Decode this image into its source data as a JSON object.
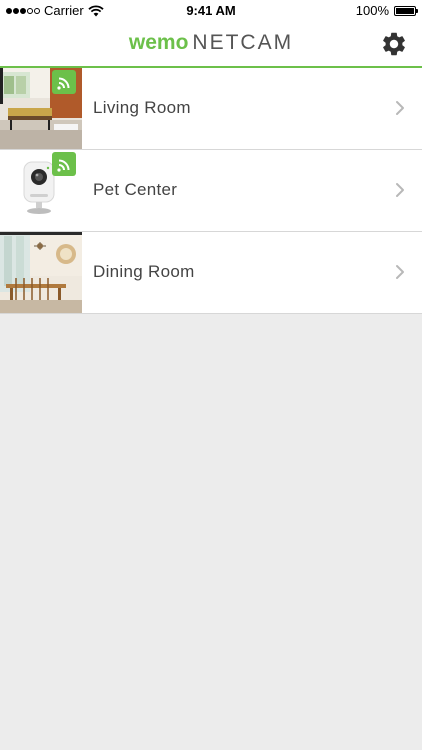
{
  "status_bar": {
    "carrier": "Carrier",
    "time": "9:41 AM",
    "battery": "100%",
    "signal_bars_filled": 3,
    "signal_bars_total": 5
  },
  "nav": {
    "brand_wemo": "wemo",
    "brand_netcam": "NETCAM",
    "settings_icon": "gear-icon"
  },
  "colors": {
    "brand_green": "#6cc04a",
    "list_bg": "#ececec"
  },
  "cameras": [
    {
      "name": "Living Room",
      "thumb": "living-room-photo",
      "badge": "wifi-signal-icon"
    },
    {
      "name": "Pet Center",
      "thumb": "netcam-device-photo",
      "badge": "wifi-signal-icon"
    },
    {
      "name": "Dining Room",
      "thumb": "dining-room-photo"
    }
  ]
}
